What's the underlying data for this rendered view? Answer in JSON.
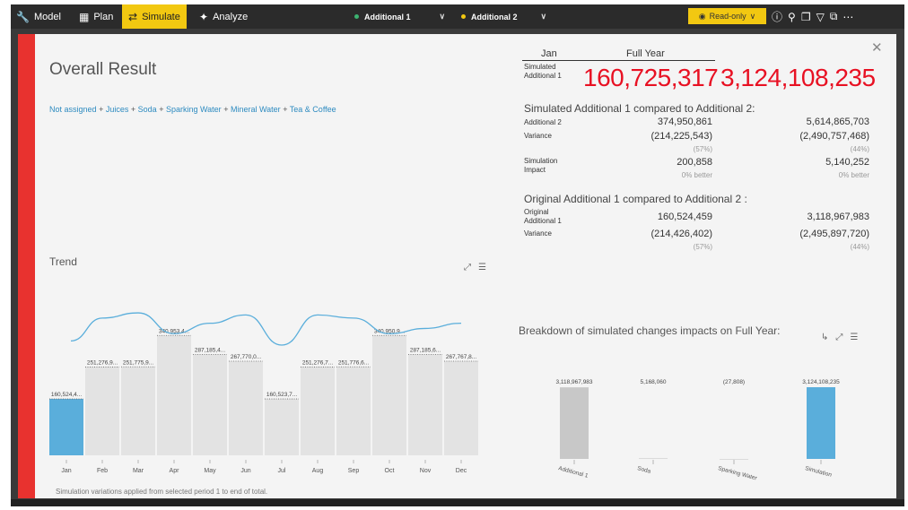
{
  "toolbar": {
    "items": [
      {
        "label": "Model",
        "icon": "wrench-icon"
      },
      {
        "label": "Plan",
        "icon": "grid-icon"
      },
      {
        "label": "Simulate",
        "icon": "simulate-icon"
      },
      {
        "label": "Analyze",
        "icon": "analyze-icon"
      }
    ],
    "scenario1": {
      "label": "Additional 1",
      "color": "#3cb371"
    },
    "scenario2": {
      "label": "Additional 2",
      "color": "#f2c811"
    },
    "readonly_label": "Read-only"
  },
  "modal": {
    "title": "Overall Result",
    "filters": [
      "Not assigned",
      "Juices",
      "Soda",
      "Sparking Water",
      "Mineral Water",
      "Tea & Coffee"
    ],
    "filter_sep": "+",
    "trend_title": "Trend",
    "note": "Simulation variations applied from selected period 1 to end of total."
  },
  "summary": {
    "col_jan": "Jan",
    "col_full": "Full Year",
    "simulated_label_1": "Simulated",
    "simulated_label_2": "Additional 1",
    "big_jan": "160,725,317",
    "big_full": "3,124,108,235",
    "section1": "Simulated Additional 1 compared to Additional 2:",
    "additional2_label": "Additional 2",
    "additional2_jan": "374,950,861",
    "additional2_full": "5,614,865,703",
    "variance_label": "Variance",
    "variance1_jan": "(214,225,543)",
    "variance1_full": "(2,490,757,468)",
    "variance1_jan_pct": "(57%)",
    "variance1_full_pct": "(44%)",
    "sim_impact_label_1": "Simulation",
    "sim_impact_label_2": "Impact",
    "sim_impact_jan": "200,858",
    "sim_impact_full": "5,140,252",
    "sim_impact_jan_note": "0% better",
    "sim_impact_full_note": "0% better",
    "section2": "Original Additional 1 compared to Additional 2 :",
    "original_label_1": "Original",
    "original_label_2": "Additional 1",
    "original_jan": "160,524,459",
    "original_full": "3,118,967,983",
    "variance2_jan": "(214,426,402)",
    "variance2_full": "(2,495,897,720)",
    "variance2_jan_pct": "(57%)",
    "variance2_full_pct": "(44%)"
  },
  "breakdown": {
    "title": "Breakdown of simulated changes impacts on Full Year:"
  },
  "chart_data": [
    {
      "type": "bar",
      "categories": [
        "Jan",
        "Feb",
        "Mar",
        "Apr",
        "May",
        "Jun",
        "Jul",
        "Aug",
        "Sep",
        "Oct",
        "Nov",
        "Dec"
      ],
      "values": [
        160524459,
        251276900,
        251775900,
        340953400,
        287185400,
        267770000,
        160523700,
        251276700,
        251776600,
        340950900,
        287185600,
        267767800
      ],
      "data_labels": [
        "160,524,4...",
        "251,276,9...",
        "251,775,9...",
        "340,953,4...",
        "287,185,4...",
        "267,770,0...",
        "160,523,7...",
        "251,276,7...",
        "251,776,6...",
        "340,950,9...",
        "287,185,6...",
        "267,767,8..."
      ],
      "highlight_index": 0,
      "bar_color": "#e3e3e3",
      "highlight_color": "#5aaedb",
      "line_color": "#5aaedb",
      "line_values": [
        0.08,
        0.52,
        0.62,
        0.22,
        0.42,
        0.58,
        0.0,
        0.58,
        0.52,
        0.22,
        0.32,
        0.42
      ],
      "ylim": [
        0,
        400000000
      ]
    },
    {
      "type": "bar",
      "categories": [
        "Additional 1",
        "Soda",
        "Sparking Water",
        "Simulation"
      ],
      "values": [
        3118967983,
        5168060,
        -27808,
        3124108235
      ],
      "data_labels": [
        "3,118,967,983",
        "5,168,060",
        "(27,808)",
        "3,124,108,235"
      ],
      "colors": [
        "#c8c8c8",
        "#c8c8c8",
        "#c8c8c8",
        "#5aaedb"
      ],
      "ylim": [
        0,
        3124108235
      ]
    }
  ]
}
